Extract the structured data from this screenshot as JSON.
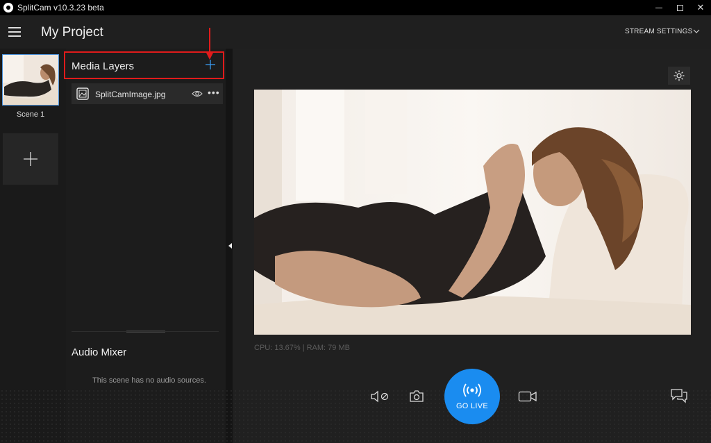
{
  "window": {
    "title": "SplitCam v10.3.23 beta",
    "minimize_symbol": "",
    "close_symbol": "✕"
  },
  "header": {
    "project_title": "My Project",
    "stream_settings_label": "STREAM SETTINGS"
  },
  "scenes": {
    "items": [
      {
        "label": "Scene 1",
        "selected": true
      }
    ]
  },
  "media_layers": {
    "title": "Media Layers",
    "items": [
      {
        "name": "SplitCamImage.jpg",
        "visible": true
      }
    ],
    "more_symbol": "•••"
  },
  "audio_mixer": {
    "title": "Audio Mixer",
    "empty_message": "This scene has no audio sources."
  },
  "preview": {
    "stats": "CPU: 13.67% | RAM: 79 MB"
  },
  "controls": {
    "go_live_label": "GO LIVE",
    "icons": [
      "mute-mic-icon",
      "camera-snapshot-icon",
      "broadcast-icon",
      "video-record-icon",
      "chat-icon"
    ]
  },
  "colors": {
    "accent": "#1a8cf0",
    "annotation": "#e01b1b",
    "background": "#1f1f1f",
    "titlebar": "#000000"
  }
}
